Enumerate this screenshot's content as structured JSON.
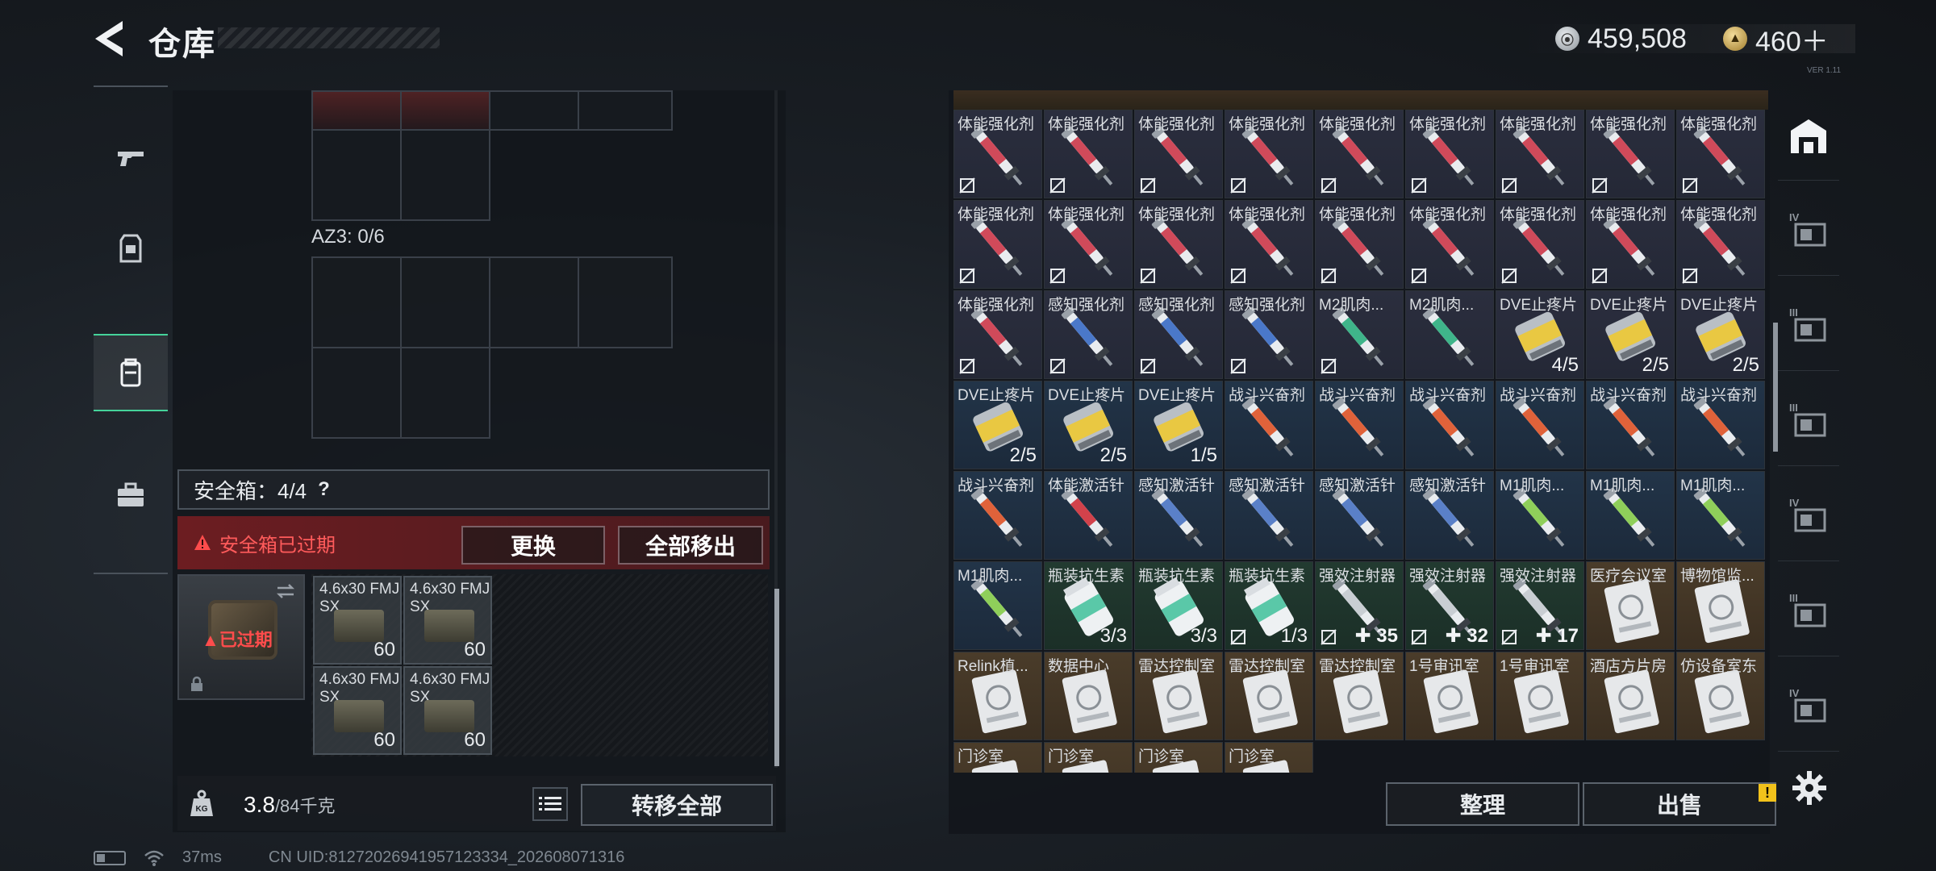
{
  "header": {
    "title": "仓库",
    "currency_silver": "459,508",
    "currency_gold": "460＋",
    "version": "VER 1.11"
  },
  "left_nav": [
    {
      "name": "weapons",
      "icon": "pistol-icon"
    },
    {
      "name": "armor",
      "icon": "armor-vest-icon"
    },
    {
      "name": "backpack",
      "icon": "backpack-icon",
      "active": true
    },
    {
      "name": "case",
      "icon": "briefcase-icon"
    }
  ],
  "left_panel": {
    "az3_label": "AZ3: 0/6",
    "safe_label": "安全箱：4/4",
    "help": "?",
    "expired_text": "安全箱已过期",
    "replace_btn": "更换",
    "remove_all_btn": "全部移出",
    "safe_box_expired": "已过期",
    "ammo": [
      {
        "name": "4.6x30 FMJ SX",
        "count": "60"
      },
      {
        "name": "4.6x30 FMJ SX",
        "count": "60"
      },
      {
        "name": "4.6x30 FMJ SX",
        "count": "60"
      },
      {
        "name": "4.6x30 FMJ SX",
        "count": "60"
      }
    ],
    "weight_value": "3.8",
    "weight_max": "/84千克",
    "transfer_all_btn": "转移全部"
  },
  "storage": {
    "rows": [
      [
        {
          "name": "体能强化剂",
          "type": "syringe-red",
          "bg": "red",
          "nobind": true
        },
        {
          "name": "体能强化剂",
          "type": "syringe-red",
          "bg": "red",
          "nobind": true
        },
        {
          "name": "体能强化剂",
          "type": "syringe-red",
          "bg": "red",
          "nobind": true
        },
        {
          "name": "体能强化剂",
          "type": "syringe-red",
          "bg": "red",
          "nobind": true
        },
        {
          "name": "体能强化剂",
          "type": "syringe-red",
          "bg": "red",
          "nobind": true
        },
        {
          "name": "体能强化剂",
          "type": "syringe-red",
          "bg": "red",
          "nobind": true
        },
        {
          "name": "体能强化剂",
          "type": "syringe-red",
          "bg": "red",
          "nobind": true
        },
        {
          "name": "体能强化剂",
          "type": "syringe-red",
          "bg": "red",
          "nobind": true
        },
        {
          "name": "体能强化剂",
          "type": "syringe-red",
          "bg": "red",
          "nobind": true
        }
      ],
      [
        {
          "name": "体能强化剂",
          "type": "syringe-red",
          "bg": "red",
          "nobind": true
        },
        {
          "name": "体能强化剂",
          "type": "syringe-red",
          "bg": "red",
          "nobind": true
        },
        {
          "name": "体能强化剂",
          "type": "syringe-red",
          "bg": "red",
          "nobind": true
        },
        {
          "name": "体能强化剂",
          "type": "syringe-red",
          "bg": "red",
          "nobind": true
        },
        {
          "name": "体能强化剂",
          "type": "syringe-red",
          "bg": "red",
          "nobind": true
        },
        {
          "name": "体能强化剂",
          "type": "syringe-red",
          "bg": "red",
          "nobind": true
        },
        {
          "name": "体能强化剂",
          "type": "syringe-red",
          "bg": "red",
          "nobind": true
        },
        {
          "name": "体能强化剂",
          "type": "syringe-red",
          "bg": "red",
          "nobind": true
        },
        {
          "name": "体能强化剂",
          "type": "syringe-red",
          "bg": "red",
          "nobind": true
        }
      ],
      [
        {
          "name": "体能强化剂",
          "type": "syringe-red",
          "bg": "red",
          "nobind": true
        },
        {
          "name": "感知强化剂",
          "type": "syringe-blue",
          "bg": "red",
          "nobind": true
        },
        {
          "name": "感知强化剂",
          "type": "syringe-blue",
          "bg": "red",
          "nobind": true
        },
        {
          "name": "感知强化剂",
          "type": "syringe-blue",
          "bg": "red",
          "nobind": true
        },
        {
          "name": "M2肌肉...",
          "type": "syringe-green",
          "bg": "red",
          "nobind": true
        },
        {
          "name": "M2肌肉...",
          "type": "syringe-green",
          "bg": "red",
          "nobind": false
        },
        {
          "name": "DVE止疼片",
          "type": "pill",
          "bg": "red",
          "count": "4/5"
        },
        {
          "name": "DVE止疼片",
          "type": "pill",
          "bg": "red",
          "count": "2/5"
        },
        {
          "name": "DVE止疼片",
          "type": "pill",
          "bg": "red",
          "count": "2/5"
        }
      ],
      [
        {
          "name": "DVE止疼片",
          "type": "pill",
          "bg": "blue",
          "count": "2/5"
        },
        {
          "name": "DVE止疼片",
          "type": "pill",
          "bg": "blue",
          "count": "2/5"
        },
        {
          "name": "DVE止疼片",
          "type": "pill",
          "bg": "blue",
          "count": "1/5"
        },
        {
          "name": "战斗兴奋剂",
          "type": "injector-orange",
          "bg": "blue"
        },
        {
          "name": "战斗兴奋剂",
          "type": "injector-orange",
          "bg": "blue"
        },
        {
          "name": "战斗兴奋剂",
          "type": "injector-orange",
          "bg": "blue"
        },
        {
          "name": "战斗兴奋剂",
          "type": "injector-orange",
          "bg": "blue"
        },
        {
          "name": "战斗兴奋剂",
          "type": "injector-orange",
          "bg": "blue"
        },
        {
          "name": "战斗兴奋剂",
          "type": "injector-orange",
          "bg": "blue"
        }
      ],
      [
        {
          "name": "战斗兴奋剂",
          "type": "injector-orange",
          "bg": "blue"
        },
        {
          "name": "体能激活针",
          "type": "injector-red",
          "bg": "blue"
        },
        {
          "name": "感知激活针",
          "type": "injector-blue",
          "bg": "blue"
        },
        {
          "name": "感知激活针",
          "type": "injector-blue",
          "bg": "blue"
        },
        {
          "name": "感知激活针",
          "type": "injector-blue",
          "bg": "blue"
        },
        {
          "name": "感知激活针",
          "type": "injector-blue",
          "bg": "blue"
        },
        {
          "name": "M1肌肉...",
          "type": "injector-green",
          "bg": "blue"
        },
        {
          "name": "M1肌肉...",
          "type": "injector-green",
          "bg": "blue"
        },
        {
          "name": "M1肌肉...",
          "type": "injector-green",
          "bg": "blue"
        }
      ],
      [
        {
          "name": "M1肌肉...",
          "type": "injector-green",
          "bg": "blue"
        },
        {
          "name": "瓶装抗生素",
          "type": "bottle",
          "bg": "green",
          "count": "3/3"
        },
        {
          "name": "瓶装抗生素",
          "type": "bottle",
          "bg": "green",
          "count": "3/3"
        },
        {
          "name": "瓶装抗生素",
          "type": "bottle",
          "bg": "green",
          "count": "1/3",
          "nobind": true
        },
        {
          "name": "强效注射器",
          "type": "injector-white",
          "bg": "green",
          "plus": "35",
          "nobind": true
        },
        {
          "name": "强效注射器",
          "type": "injector-white",
          "bg": "green",
          "plus": "32",
          "nobind": true
        },
        {
          "name": "强效注射器",
          "type": "injector-white",
          "bg": "green",
          "plus": "17",
          "nobind": true
        },
        {
          "name": "医疗会议室",
          "type": "keycard",
          "bg": "gold"
        },
        {
          "name": "博物馆监...",
          "type": "keycard",
          "bg": "gold"
        }
      ],
      [
        {
          "name": "Relink植...",
          "type": "keycard",
          "bg": "gold"
        },
        {
          "name": "数据中心",
          "type": "keycard",
          "bg": "gold"
        },
        {
          "name": "雷达控制室",
          "type": "keycard",
          "bg": "gold"
        },
        {
          "name": "雷达控制室",
          "type": "keycard",
          "bg": "gold"
        },
        {
          "name": "雷达控制室",
          "type": "keycard",
          "bg": "gold"
        },
        {
          "name": "1号审讯室",
          "type": "keycard",
          "bg": "gold"
        },
        {
          "name": "1号审讯室",
          "type": "keycard",
          "bg": "gold"
        },
        {
          "name": "酒店方片房",
          "type": "keycard",
          "bg": "gold"
        },
        {
          "name": "仿设备室东",
          "type": "keycard",
          "bg": "gold"
        }
      ],
      [
        {
          "name": "门诊室",
          "type": "keycard",
          "bg": "gold"
        },
        {
          "name": "门诊室",
          "type": "keycard",
          "bg": "gold"
        },
        {
          "name": "门诊室",
          "type": "keycard",
          "bg": "gold"
        },
        {
          "name": "门诊室",
          "type": "keycard",
          "bg": "gold"
        }
      ]
    ],
    "sort_btn": "整理",
    "sell_btn": "出售",
    "sell_alert": "!"
  },
  "right_nav": [
    {
      "name": "all",
      "icon": "warehouse-icon"
    },
    {
      "name": "tier-4-a",
      "icon": "tier-IV-icon"
    },
    {
      "name": "tier-3-a",
      "icon": "tier-III-icon"
    },
    {
      "name": "tier-3-b",
      "icon": "tier-III-icon"
    },
    {
      "name": "tier-4-b",
      "icon": "tier-IV-icon"
    },
    {
      "name": "tier-3-c",
      "icon": "tier-III-icon"
    },
    {
      "name": "tier-4-c",
      "icon": "tier-IV-icon"
    }
  ],
  "status_bar": {
    "ping": "37ms",
    "uid": "CN UID:81272026941957123334_202608071316"
  },
  "colors": {
    "accent_green": "#45d39a",
    "expired_red": "#ff4c4c",
    "gold_item_bg": "#4a3c2a",
    "alert_yellow": "#f2c21b"
  }
}
